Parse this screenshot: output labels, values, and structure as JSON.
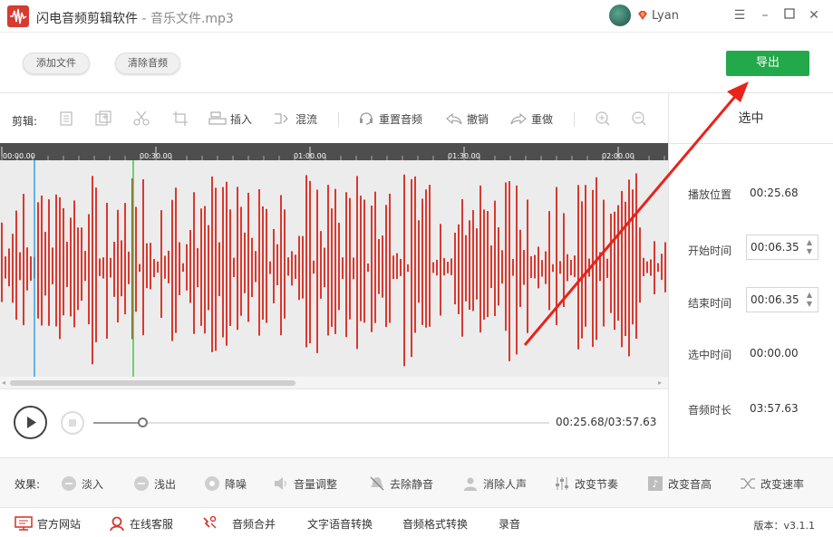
{
  "window": {
    "app_name": "闪电音频剪辑软件",
    "separator": " - ",
    "file_name": "音乐文件.mp3",
    "username": "Lyan",
    "min_icon": "minimize-icon",
    "max_icon": "maximize-icon",
    "close_icon": "close-icon",
    "menu_icon": "menu-icon"
  },
  "actions": {
    "add_file": "添加文件",
    "clear_audio": "清除音频",
    "export": "导出"
  },
  "toolbar": {
    "label": "剪辑:",
    "insert": "插入",
    "mix": "混流",
    "reset": "重置音频",
    "undo": "撤销",
    "redo": "重做"
  },
  "timeline": {
    "ticks": [
      "00:00.00",
      "00:30.00",
      "01:00.00",
      "01:30.00",
      "02:00.00"
    ]
  },
  "player": {
    "time": "00:25.68/03:57.63",
    "progress": 0.11
  },
  "right_panel": {
    "header": "选中",
    "playback_label": "播放位置",
    "playback_value": "00:25.68",
    "start_label": "开始时间",
    "start_value": "00:06.35",
    "end_label": "结束时间",
    "end_value": "00:06.35",
    "selected_label": "选中时间",
    "selected_value": "00:00.00",
    "duration_label": "音频时长",
    "duration_value": "03:57.63"
  },
  "effects": {
    "label": "效果:",
    "items": [
      "淡入",
      "浅出",
      "降噪",
      "音量调整",
      "去除静音",
      "消除人声",
      "改变节奏",
      "改变音高",
      "改变速率"
    ]
  },
  "footer": {
    "website": "官方网站",
    "support": "在线客服",
    "merge": "音频合并",
    "tts": "文字语音转换",
    "convert": "音频格式转换",
    "record": "录音",
    "version": "版本：v3.1.1"
  },
  "colors": {
    "accent": "#22a94a",
    "wave": "#d63a31",
    "cursor_blue": "#3aa0e0",
    "cursor_green": "#3ccb3c"
  }
}
